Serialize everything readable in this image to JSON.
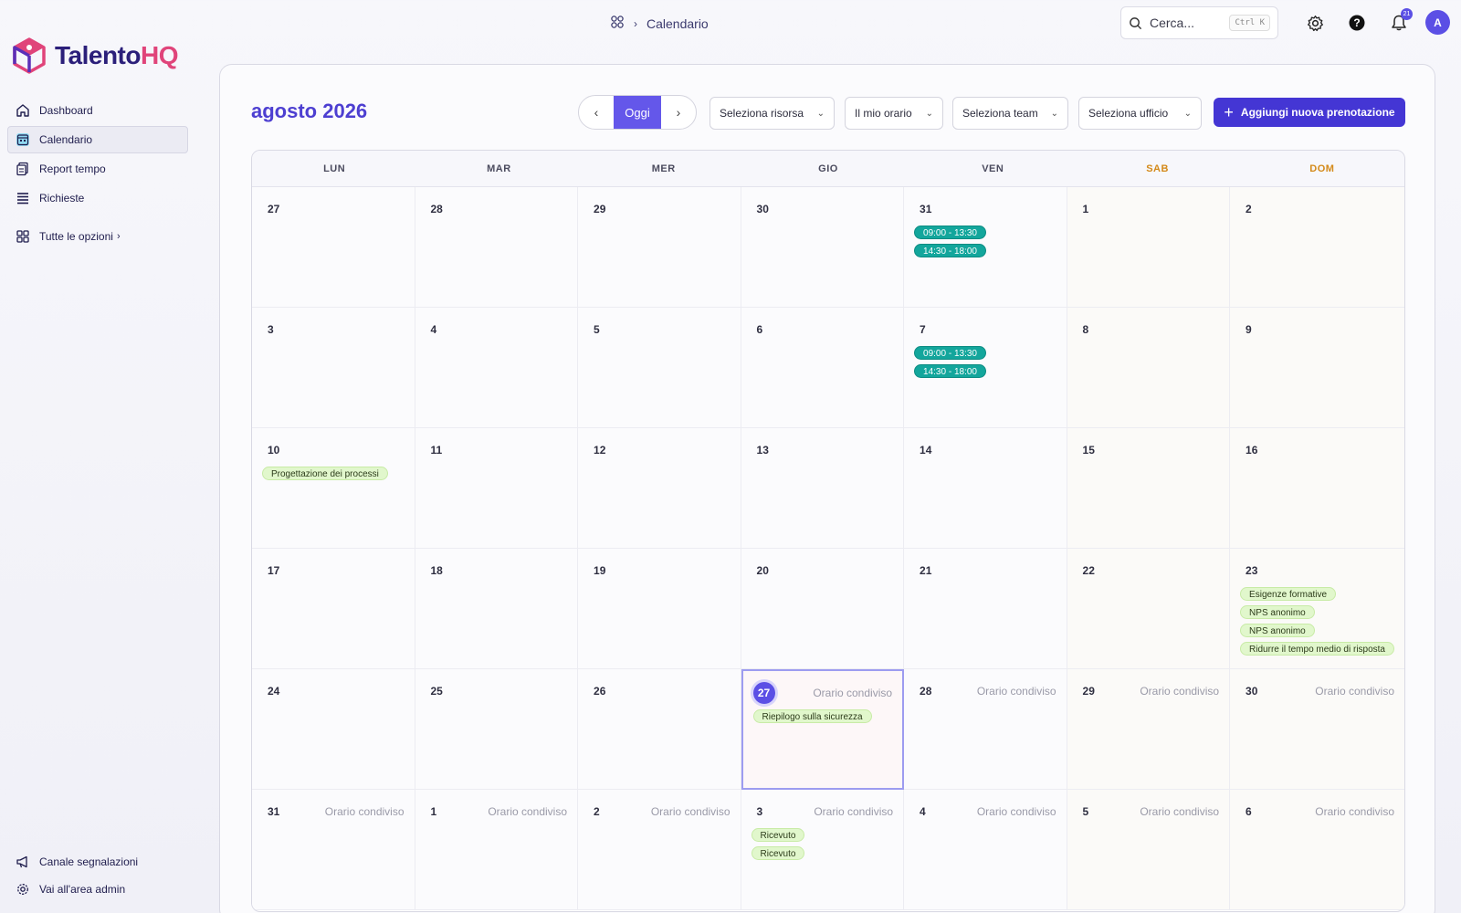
{
  "brand": {
    "name_part1": "Talento",
    "name_part2": "HQ"
  },
  "sidebar": {
    "items": [
      {
        "label": "Dashboard",
        "icon": "home-icon"
      },
      {
        "label": "Calendario",
        "icon": "calendar-icon",
        "active": true
      },
      {
        "label": "Report tempo",
        "icon": "report-icon"
      },
      {
        "label": "Richieste",
        "icon": "list-icon"
      },
      {
        "label": "Tutte le opzioni",
        "icon": "grid-icon"
      }
    ],
    "bottom": [
      {
        "label": "Canale segnalazioni",
        "icon": "megaphone-icon"
      },
      {
        "label": "Vai all'area admin",
        "icon": "gear-icon"
      }
    ]
  },
  "header": {
    "breadcrumb": "Calendario",
    "search_placeholder": "Cerca...",
    "search_shortcut": "Ctrl K",
    "notification_count": "21",
    "avatar_initial": "A"
  },
  "toolbar": {
    "month_title": "agosto 2026",
    "today_label": "Oggi",
    "dropdowns": [
      "Seleziona risorsa",
      "Il mio orario",
      "Seleziona team",
      "Seleziona ufficio"
    ],
    "add_label": "Aggiungi nuova prenotazione"
  },
  "calendar": {
    "weekdays": [
      "LUN",
      "MAR",
      "MER",
      "GIO",
      "VEN",
      "SAB",
      "DOM"
    ],
    "shared_label": "Orario condiviso",
    "weeks": [
      [
        {
          "d": "27"
        },
        {
          "d": "28"
        },
        {
          "d": "29"
        },
        {
          "d": "30"
        },
        {
          "d": "31",
          "events": [
            {
              "t": "09:00 - 13:30",
              "k": "time"
            },
            {
              "t": "14:30 - 18:00",
              "k": "time"
            }
          ]
        },
        {
          "d": "1"
        },
        {
          "d": "2"
        }
      ],
      [
        {
          "d": "3"
        },
        {
          "d": "4"
        },
        {
          "d": "5"
        },
        {
          "d": "6"
        },
        {
          "d": "7",
          "events": [
            {
              "t": "09:00 - 13:30",
              "k": "time"
            },
            {
              "t": "14:30 - 18:00",
              "k": "time"
            }
          ]
        },
        {
          "d": "8"
        },
        {
          "d": "9"
        }
      ],
      [
        {
          "d": "10",
          "events": [
            {
              "t": "Progettazione dei processi",
              "k": "green"
            }
          ]
        },
        {
          "d": "11"
        },
        {
          "d": "12"
        },
        {
          "d": "13"
        },
        {
          "d": "14"
        },
        {
          "d": "15"
        },
        {
          "d": "16"
        }
      ],
      [
        {
          "d": "17"
        },
        {
          "d": "18"
        },
        {
          "d": "19"
        },
        {
          "d": "20"
        },
        {
          "d": "21"
        },
        {
          "d": "22"
        },
        {
          "d": "23",
          "events": [
            {
              "t": "Esigenze formative",
              "k": "green"
            },
            {
              "t": "NPS anonimo",
              "k": "green"
            },
            {
              "t": "NPS anonimo",
              "k": "green"
            },
            {
              "t": "Ridurre il tempo medio di risposta",
              "k": "green"
            }
          ]
        }
      ],
      [
        {
          "d": "24"
        },
        {
          "d": "25"
        },
        {
          "d": "26"
        },
        {
          "d": "27",
          "today": true,
          "shared": true,
          "events": [
            {
              "t": "Riepilogo sulla sicurezza",
              "k": "green"
            }
          ]
        },
        {
          "d": "28",
          "shared": true
        },
        {
          "d": "29",
          "shared": true
        },
        {
          "d": "30",
          "shared": true
        }
      ],
      [
        {
          "d": "31",
          "shared": true
        },
        {
          "d": "1",
          "shared": true
        },
        {
          "d": "2",
          "shared": true
        },
        {
          "d": "3",
          "shared": true,
          "events": [
            {
              "t": "Ricevuto",
              "k": "green"
            },
            {
              "t": "Ricevuto",
              "k": "green"
            }
          ]
        },
        {
          "d": "4",
          "shared": true
        },
        {
          "d": "5",
          "shared": true
        },
        {
          "d": "6",
          "shared": true
        }
      ]
    ]
  },
  "colors": {
    "accent": "#5b4fe5",
    "brand_pink": "#e0447a",
    "event_time": "#13a69c",
    "event_green": "#e1f7cc",
    "weekend": "#d48a1a"
  }
}
